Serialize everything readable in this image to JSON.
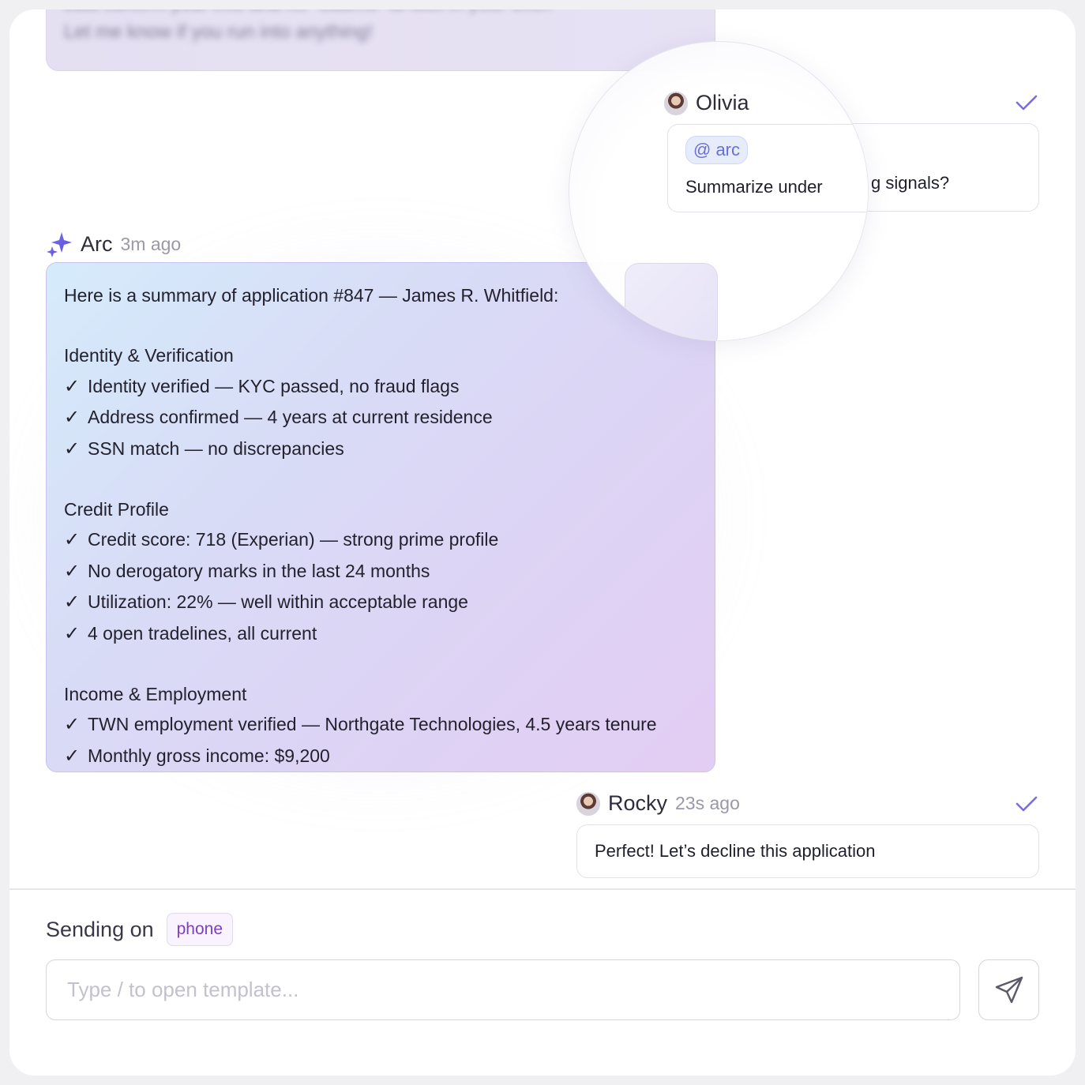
{
  "top_message": {
    "lines": [
      "Just confirm your info and hit \"Submit\" to lock in your offer.",
      "Let me know if you run into anything!"
    ]
  },
  "olivia_message": {
    "author": "Olivia",
    "mention": "@ arc",
    "text_visible_left": "Summarize under",
    "text_visible_right": "g signals?",
    "status_icon": "check-icon"
  },
  "arc_message": {
    "author": "Arc",
    "time": "3m ago",
    "icon": "sparkle-icon",
    "intro": "Here is a summary of application #847 — James R. Whitfield:",
    "sections": [
      {
        "title": "Identity & Verification",
        "items": [
          "Identity verified — KYC passed, no fraud flags",
          "Address confirmed — 4 years at current residence",
          "SSN match — no discrepancies"
        ]
      },
      {
        "title": "Credit Profile",
        "items": [
          "Credit score: 718 (Experian) — strong prime profile",
          "No derogatory marks in the last 24 months",
          "Utilization: 22% — well within acceptable range",
          "4 open tradelines, all current"
        ]
      },
      {
        "title": "Income & Employment",
        "items": [
          "TWN employment verified — Northgate Technologies, 4.5 years tenure",
          "Monthly gross income: $9,200"
        ]
      }
    ],
    "check_glyph": "✓"
  },
  "rocky_message": {
    "author": "Rocky",
    "time": "23s ago",
    "text": "Perfect! Let’s decline this application",
    "status_icon": "check-icon"
  },
  "composer": {
    "sending_label": "Sending on",
    "channel": "phone",
    "placeholder": "Type / to open template...",
    "send_icon": "send-icon"
  },
  "colors": {
    "accent": "#7b6fe0",
    "channel_text": "#7e3fbf"
  }
}
